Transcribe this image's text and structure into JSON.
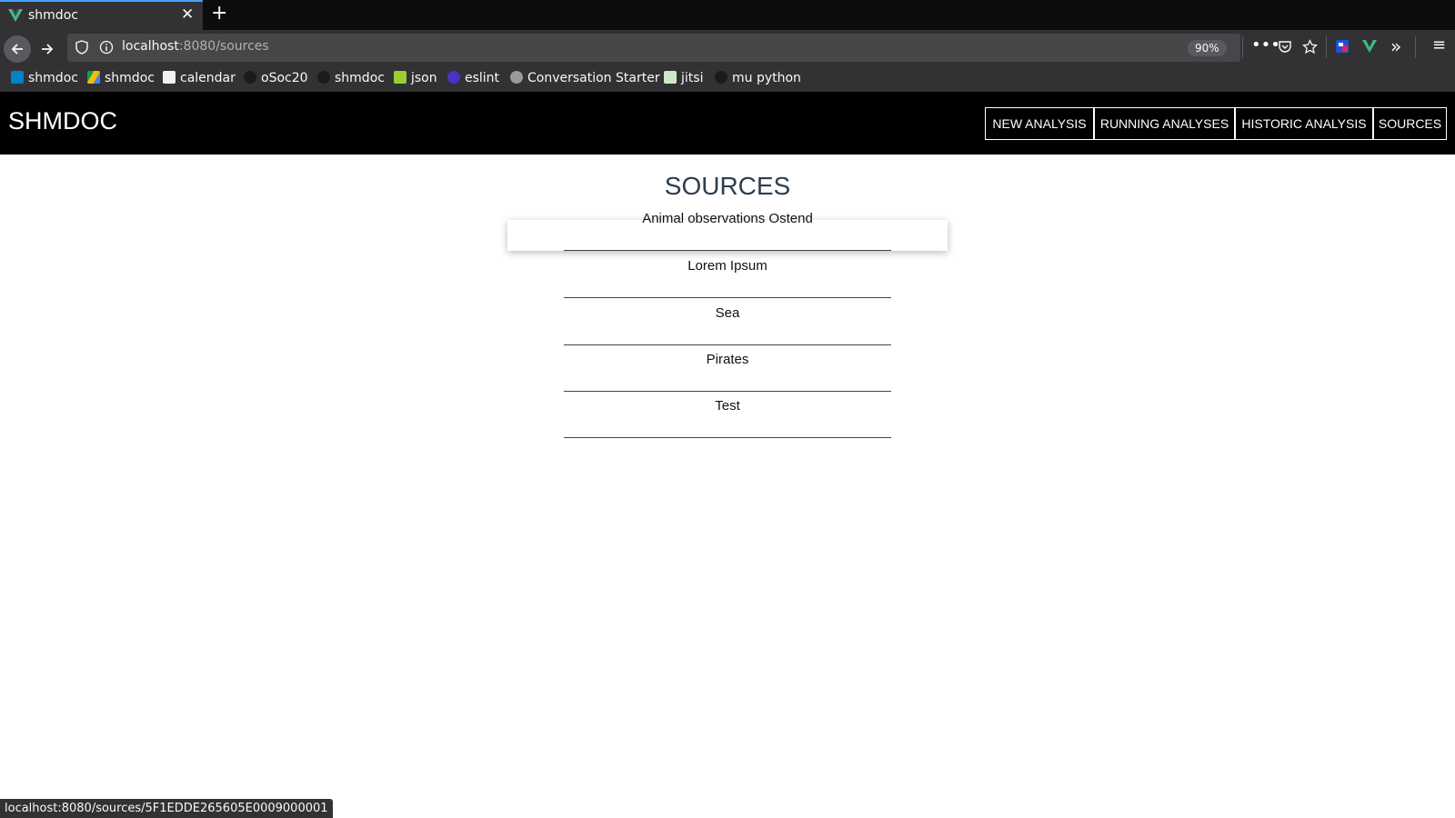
{
  "browser": {
    "tab_title": "shmdoc",
    "url_host": "localhost",
    "url_rest": ":8080/sources",
    "zoom": "90%",
    "bookmarks": [
      {
        "label": "shmdoc",
        "icon": "nextcloud-icon"
      },
      {
        "label": "shmdoc",
        "icon": "google-drive-icon"
      },
      {
        "label": "calendar",
        "icon": "calendar-icon"
      },
      {
        "label": "oSoc20",
        "icon": "github-icon"
      },
      {
        "label": "shmdoc",
        "icon": "github-icon"
      },
      {
        "label": "json",
        "icon": "json-icon"
      },
      {
        "label": "eslint",
        "icon": "eslint-icon"
      },
      {
        "label": "Conversation Starter",
        "icon": "globe-icon"
      },
      {
        "label": "jitsi",
        "icon": "jitsi-icon"
      },
      {
        "label": "mu python",
        "icon": "github-icon"
      }
    ],
    "status_url": "localhost:8080/sources/5F1EDDE265605E0009000001"
  },
  "app": {
    "brand": "SHMDOC",
    "nav": [
      "NEW ANALYSIS",
      "RUNNING ANALYSES",
      "HISTORIC ANALYSIS",
      "SOURCES"
    ],
    "page_title": "SOURCES",
    "sources": [
      "Animal observations Ostend",
      "Lorem Ipsum",
      "Sea",
      "Pirates",
      "Test"
    ]
  },
  "colors": {
    "header_bg": "#000000",
    "title_color": "#2c3e50",
    "chrome_bg": "#323234"
  }
}
